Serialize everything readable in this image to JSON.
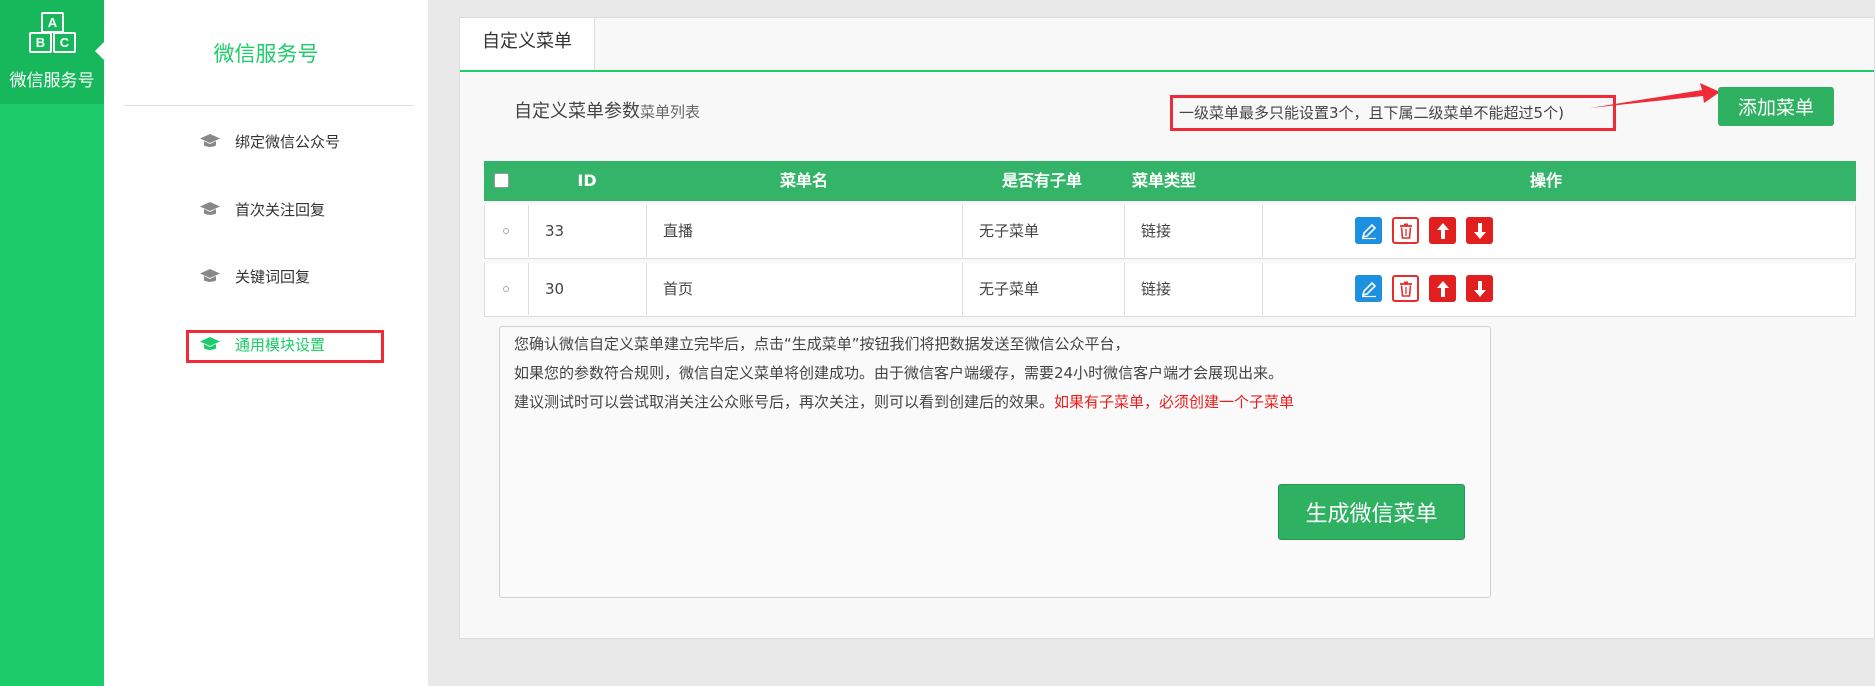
{
  "rail": {
    "logo_letters": [
      "A",
      "B",
      "C"
    ],
    "label": "微信服务号"
  },
  "sidebar": {
    "title": "微信服务号",
    "items": [
      {
        "label": "绑定微信公众号",
        "icon": "graduation-cap-icon",
        "active": false
      },
      {
        "label": "首次关注回复",
        "icon": "graduation-cap-icon",
        "active": false
      },
      {
        "label": "关键词回复",
        "icon": "graduation-cap-icon",
        "active": false
      },
      {
        "label": "通用模块设置",
        "icon": "graduation-cap-icon",
        "active": true
      }
    ]
  },
  "main": {
    "tab": "自定义菜单",
    "params_label": "自定义菜单参数",
    "list_label": "菜单列表",
    "limit_hint": "一级菜单最多只能设置3个，且下属二级菜单不能超过5个)",
    "add_button": "添加菜单",
    "table": {
      "headers": [
        "ID",
        "菜单名",
        "是否有子单",
        "菜单类型",
        "操作"
      ],
      "rows": [
        {
          "id": "33",
          "name": "直播",
          "has_sub": "无子菜单",
          "type": "链接"
        },
        {
          "id": "30",
          "name": "首页",
          "has_sub": "无子菜单",
          "type": "链接"
        }
      ]
    },
    "note": {
      "line1": "您确认微信自定义菜单建立完毕后，点击“生成菜单”按钮我们将把数据发送至微信公众平台，",
      "line2": "如果您的参数符合规则，微信自定义菜单将创建成功。由于微信客户端缓存，需要24小时微信客户端才会展现出来。",
      "line3": "建议测试时可以尝试取消关注公众账号后，再次关注，则可以看到创建后的效果。",
      "line3_red": "如果有子菜单，必须创建一个子菜单"
    },
    "generate_button": "生成微信菜单"
  },
  "colors": {
    "brand_green": "#1ccd69",
    "table_header": "#33b468",
    "button_green": "#2eb161",
    "highlight_red": "#ee2b36"
  }
}
